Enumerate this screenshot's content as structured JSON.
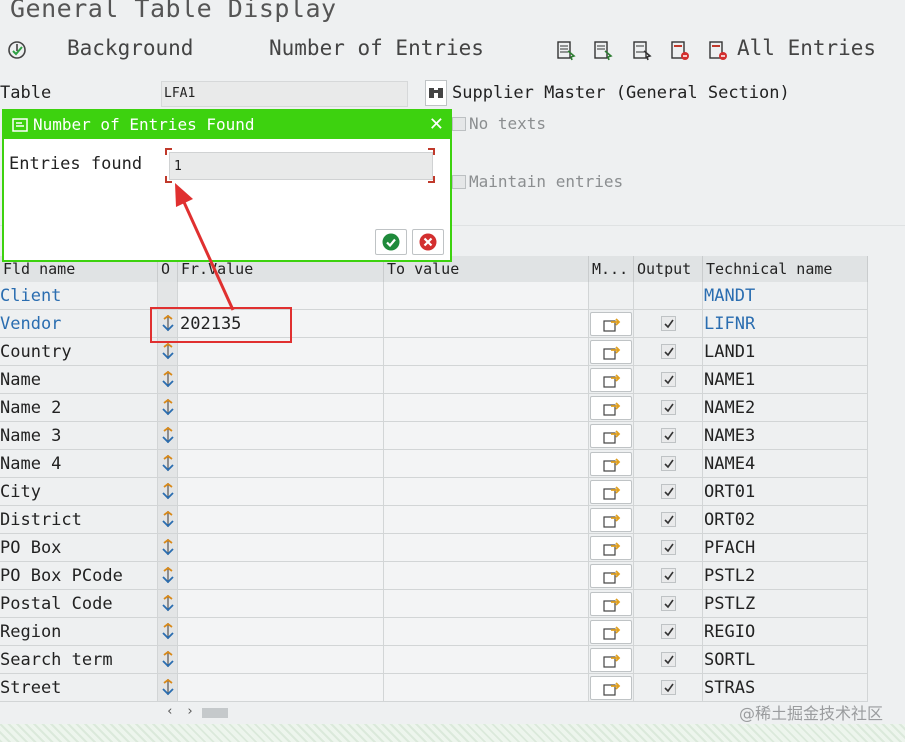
{
  "window": {
    "title": "General Table Display"
  },
  "toolbar": {
    "background_label": "Background",
    "number_of_entries_label": "Number of Entries",
    "all_entries_label": "All Entries"
  },
  "selection": {
    "table_label": "Table",
    "table_value": "LFA1",
    "table_description": "Supplier Master (General Section)",
    "no_texts_label": "No texts",
    "maintain_entries_label": "Maintain entries"
  },
  "dialog": {
    "title": "Number of Entries Found",
    "entries_found_label": "Entries found",
    "entries_found_value": "1"
  },
  "table": {
    "headers": [
      "Fld name",
      "O",
      "Fr.Value",
      "To value",
      "M...",
      "Output",
      "Technical name"
    ],
    "rows": [
      {
        "name": "Client",
        "fr": "",
        "tech": "MANDT",
        "key": true,
        "icons": false
      },
      {
        "name": "Vendor",
        "fr": "202135",
        "tech": "LIFNR",
        "key": true,
        "icons": true
      },
      {
        "name": "Country",
        "fr": "",
        "tech": "LAND1",
        "key": false,
        "icons": true
      },
      {
        "name": "Name",
        "fr": "",
        "tech": "NAME1",
        "key": false,
        "icons": true
      },
      {
        "name": "Name 2",
        "fr": "",
        "tech": "NAME2",
        "key": false,
        "icons": true
      },
      {
        "name": "Name 3",
        "fr": "",
        "tech": "NAME3",
        "key": false,
        "icons": true
      },
      {
        "name": "Name 4",
        "fr": "",
        "tech": "NAME4",
        "key": false,
        "icons": true
      },
      {
        "name": "City",
        "fr": "",
        "tech": "ORT01",
        "key": false,
        "icons": true
      },
      {
        "name": "District",
        "fr": "",
        "tech": "ORT02",
        "key": false,
        "icons": true
      },
      {
        "name": "PO Box",
        "fr": "",
        "tech": "PFACH",
        "key": false,
        "icons": true
      },
      {
        "name": "PO Box PCode",
        "fr": "",
        "tech": "PSTL2",
        "key": false,
        "icons": true
      },
      {
        "name": "Postal Code",
        "fr": "",
        "tech": "PSTLZ",
        "key": false,
        "icons": true
      },
      {
        "name": "Region",
        "fr": "",
        "tech": "REGIO",
        "key": false,
        "icons": true
      },
      {
        "name": "Search term",
        "fr": "",
        "tech": "SORTL",
        "key": false,
        "icons": true
      },
      {
        "name": "Street",
        "fr": "",
        "tech": "STRAS",
        "key": false,
        "icons": true
      }
    ]
  },
  "watermark": "@稀土掘金技术社区",
  "colors": {
    "dialog_green": "#3dd20f",
    "key_blue": "#2a6db0",
    "annotation_red": "#e03030"
  }
}
